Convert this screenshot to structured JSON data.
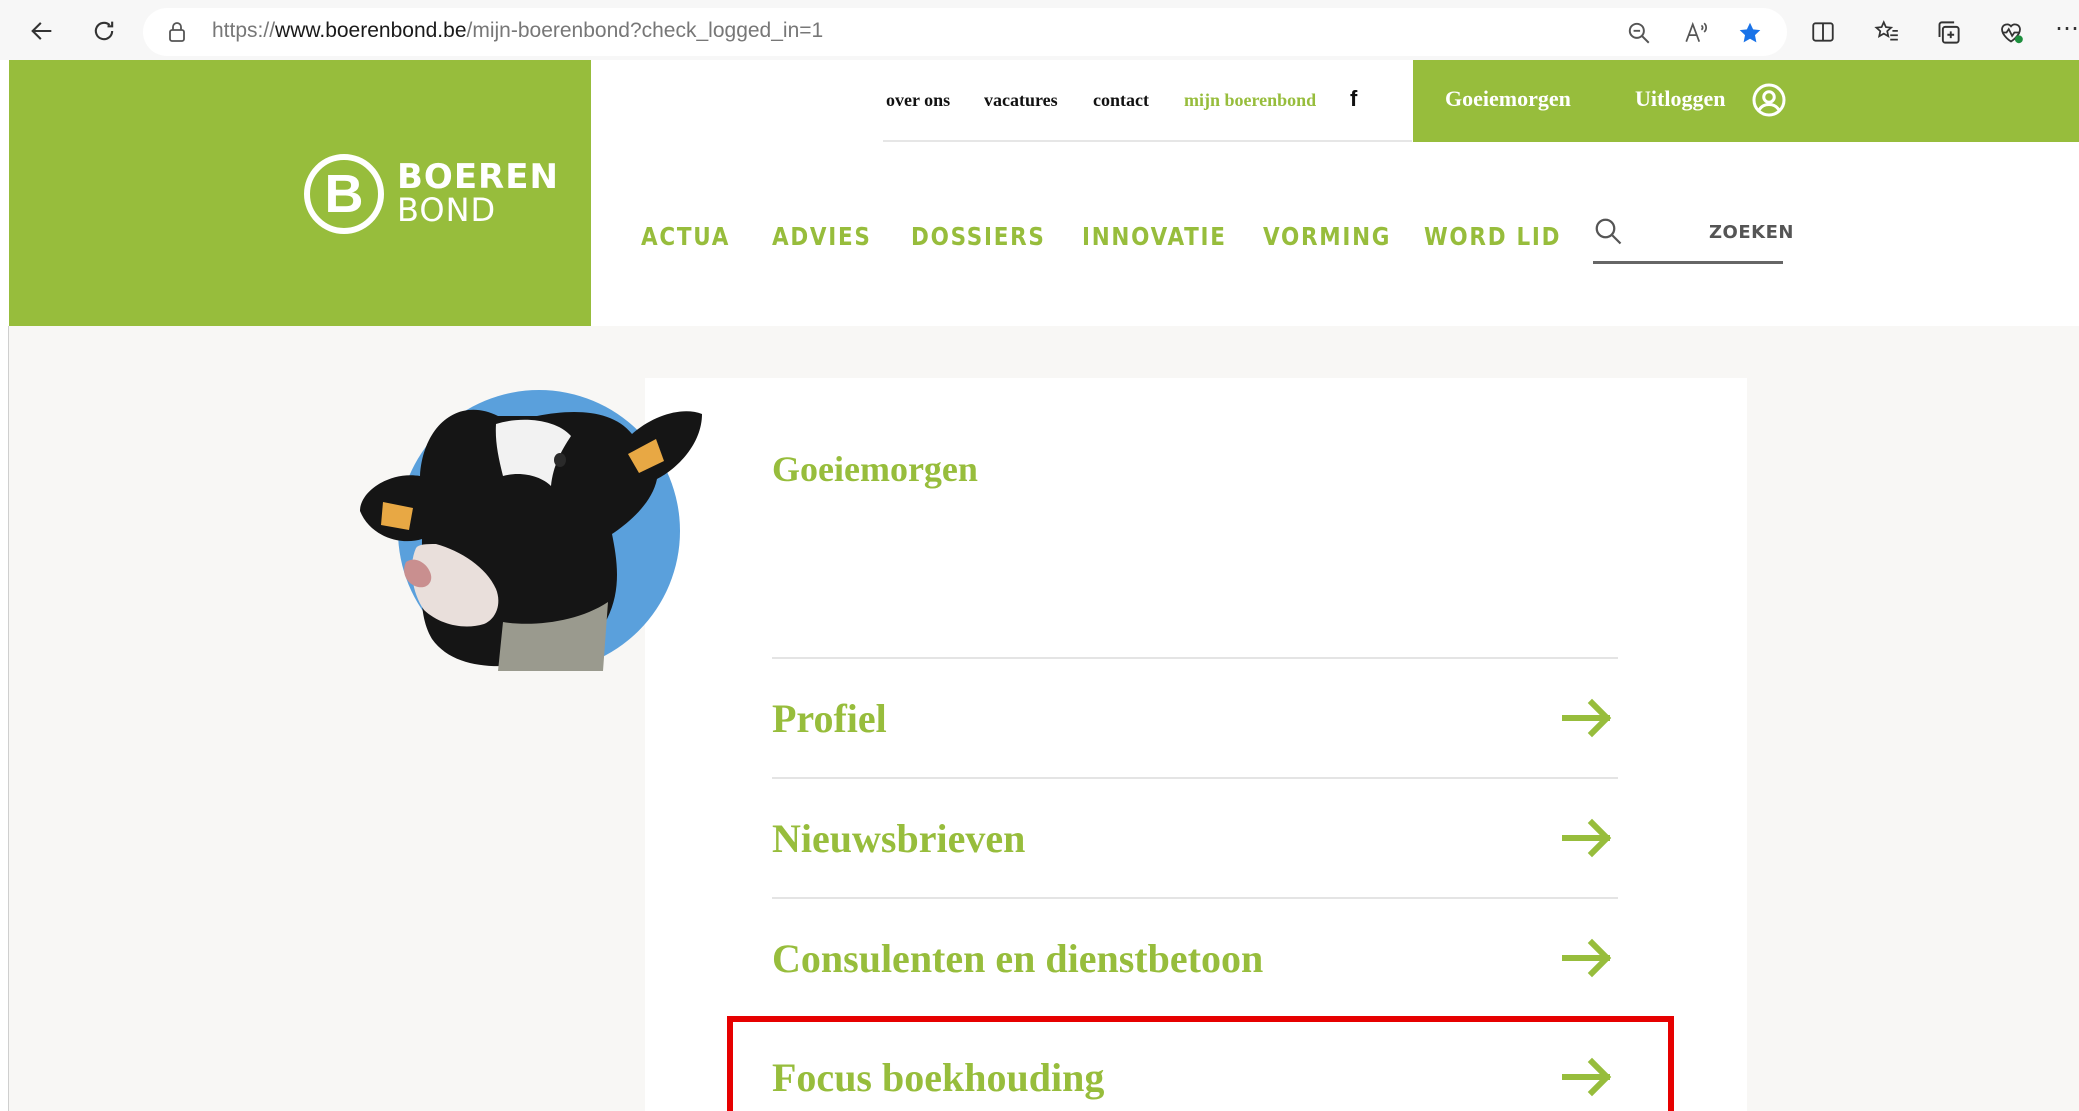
{
  "browser": {
    "url_prefix": "https://",
    "url_domain": "www.boerenbond.be",
    "url_path": "/mijn-boerenbond?check_logged_in=1"
  },
  "site": {
    "logo_line1": "BOEREN",
    "logo_line2": "BOND",
    "logo_mark": "B"
  },
  "topnav": {
    "items": [
      {
        "label": "over ons"
      },
      {
        "label": "vacatures"
      },
      {
        "label": "contact"
      },
      {
        "label": "mijn boerenbond",
        "active": true
      },
      {
        "label": "f"
      }
    ],
    "greeting": "Goeiemorgen",
    "logout": "Uitloggen"
  },
  "mainnav": {
    "items": [
      "ACTUA",
      "ADVIES",
      "DOSSIERS",
      "INNOVATIE",
      "VORMING",
      "WORD LID"
    ],
    "search_label": "ZOEKEN"
  },
  "content": {
    "title": "Goeiemorgen",
    "items": [
      {
        "label": "Profiel"
      },
      {
        "label": "Nieuwsbrieven"
      },
      {
        "label": "Consulenten en dienstbetoon"
      },
      {
        "label": "Focus boekhouding",
        "highlighted": true
      }
    ]
  },
  "colors": {
    "brand_green": "#97bd3c",
    "highlight_red": "#e60000",
    "star_blue": "#1a73e8"
  }
}
